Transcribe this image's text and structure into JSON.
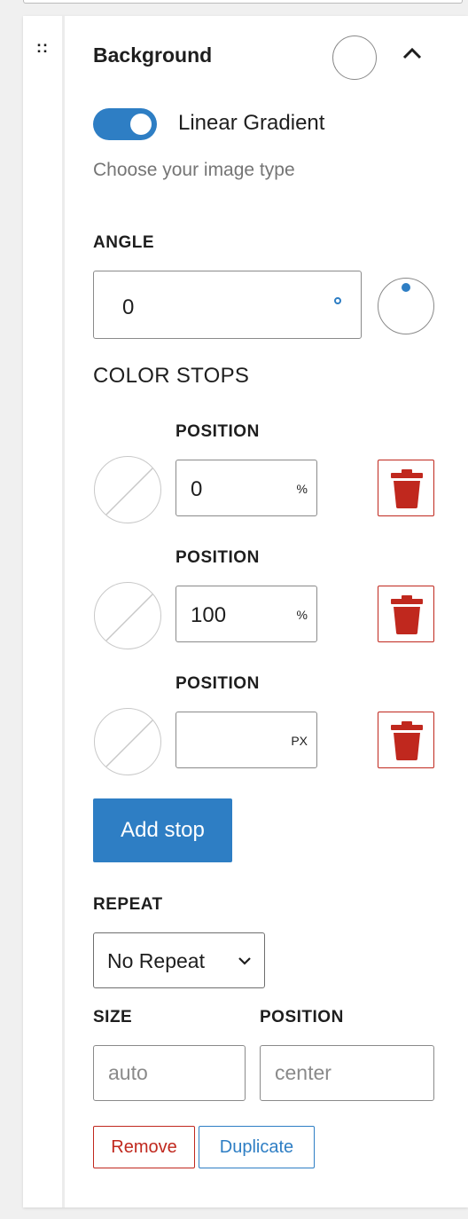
{
  "panel": {
    "title": "Background",
    "toggle_label": "Linear Gradient",
    "toggle_on": true,
    "help_text": "Choose your image type"
  },
  "angle": {
    "label": "ANGLE",
    "value": "0",
    "unit_icon": "degree-icon"
  },
  "color_stops": {
    "label": "COLOR STOPS",
    "stops": [
      {
        "position_label": "POSITION",
        "value": "0",
        "unit": "%"
      },
      {
        "position_label": "POSITION",
        "value": "100",
        "unit": "%"
      },
      {
        "position_label": "POSITION",
        "value": "",
        "unit": "PX"
      }
    ],
    "add_label": "Add stop"
  },
  "repeat": {
    "label": "REPEAT",
    "selected": "No Repeat"
  },
  "size": {
    "label": "SIZE",
    "placeholder": "auto"
  },
  "position": {
    "label": "POSITION",
    "placeholder": "center"
  },
  "actions": {
    "remove_label": "Remove",
    "duplicate_label": "Duplicate"
  },
  "colors": {
    "accent": "#2e7ec4",
    "danger": "#c0281e",
    "muted_text": "#757575"
  }
}
